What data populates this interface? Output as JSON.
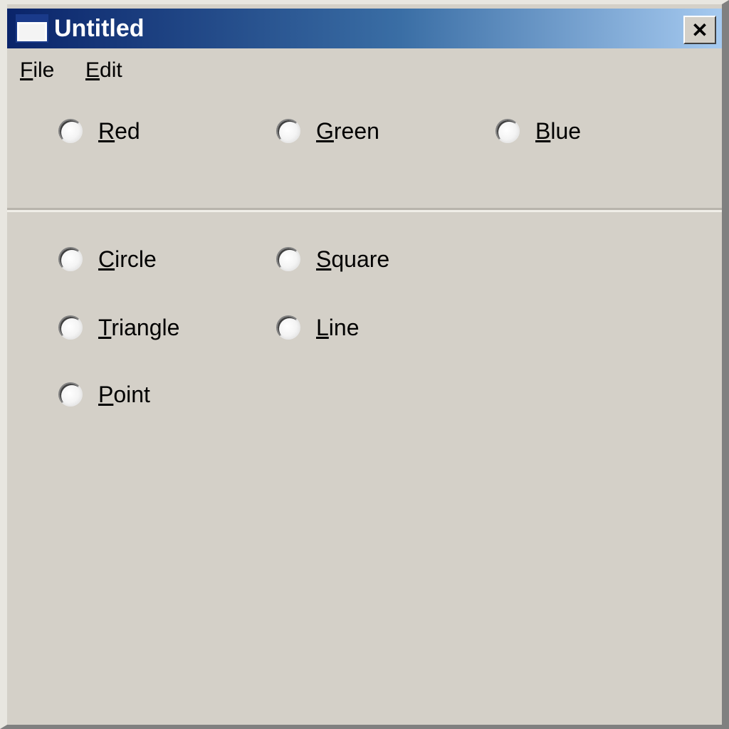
{
  "window": {
    "title": "Untitled",
    "close_glyph": "✕"
  },
  "menu": [
    {
      "accel": "F",
      "rest": "ile"
    },
    {
      "accel": "E",
      "rest": "dit"
    }
  ],
  "colors": {
    "options": [
      {
        "accel": "R",
        "rest": "ed"
      },
      {
        "accel": "G",
        "rest": "reen"
      },
      {
        "accel": "B",
        "rest": "lue"
      }
    ]
  },
  "shapes": {
    "options": [
      {
        "accel": "C",
        "rest": "ircle"
      },
      {
        "accel": "S",
        "rest": "quare"
      },
      {
        "accel": "T",
        "rest": "riangle"
      },
      {
        "accel": "L",
        "rest": "ine"
      },
      {
        "accel": "P",
        "rest": "oint"
      }
    ]
  },
  "theme": {
    "face": "#d4d0c8",
    "title_start": "#0a246a",
    "title_end": "#a6caf0"
  }
}
